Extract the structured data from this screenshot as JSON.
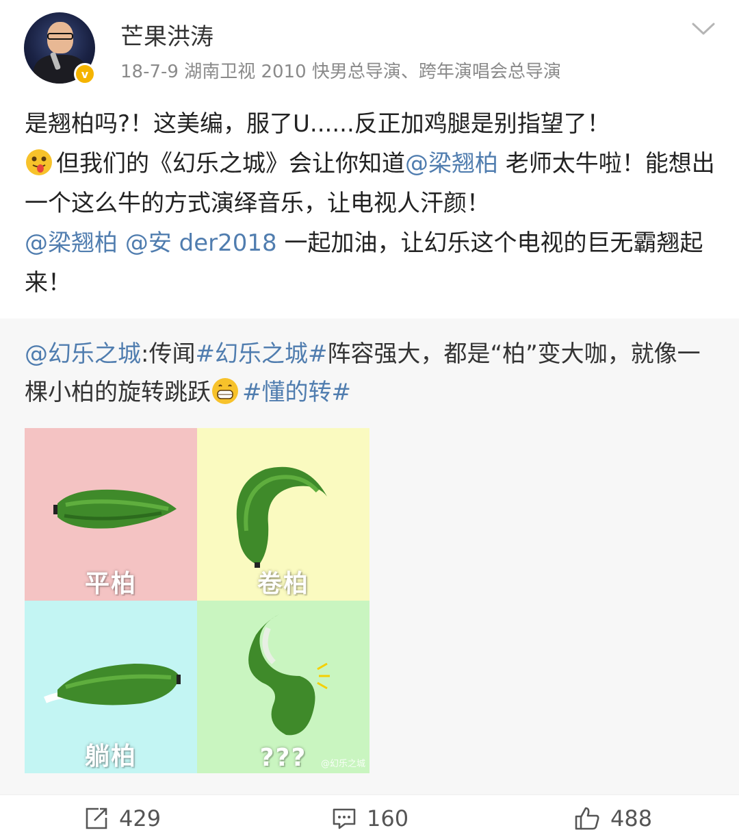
{
  "user": {
    "name": "芒果洪涛",
    "meta": "18-7-9  湖南卫视 2010 快男总导演、跨年演唱会总导演",
    "badge": "v"
  },
  "post": {
    "seg1": "是翘柏吗?！这美编，服了U......反正加鸡腿是别指望了！",
    "seg2": "但我们的《幻乐之城》会让你知道",
    "mention1": "@梁翘柏",
    "seg3": " 老师太牛啦！能想出一个这么牛的方式演绎音乐，让电视人汗颜！",
    "mention2": "@梁翘柏",
    "mention3": "@安 der2018",
    "seg4": " 一起加油，让幻乐这个电视的巨无霸翘起来！"
  },
  "repost": {
    "mention": "@幻乐之城",
    "seg1": ":传闻",
    "hashtag1": "#幻乐之城#",
    "seg2": "阵容强大，都是“柏”变大咖，就像一棵小柏的旋转跳跃",
    "hashtag2": "#懂的转#",
    "cells": [
      {
        "label": "平柏",
        "color": "#f4c3c3"
      },
      {
        "label": "卷柏",
        "color": "#fafac0"
      },
      {
        "label": "躺柏",
        "color": "#c3f5f3"
      },
      {
        "label": "???",
        "color": "#c9f5c0"
      }
    ],
    "watermark": "@幻乐之城"
  },
  "actions": {
    "repost_count": "429",
    "comment_count": "160",
    "like_count": "488"
  },
  "icons": {
    "repost": "share-icon",
    "comment": "comment-icon",
    "like": "thumbs-up-icon",
    "more": "chevron-down-icon"
  }
}
